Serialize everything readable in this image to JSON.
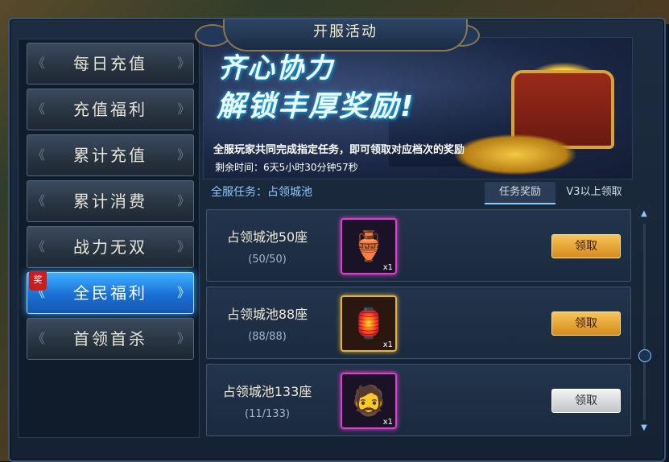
{
  "window": {
    "title": "开服活动"
  },
  "sidebar": {
    "items": [
      {
        "label": "每日充值"
      },
      {
        "label": "充值福利"
      },
      {
        "label": "累计充值"
      },
      {
        "label": "累计消费"
      },
      {
        "label": "战力无双"
      },
      {
        "label": "全民福利",
        "badge": "奖",
        "active": true
      },
      {
        "label": "首领首杀"
      }
    ]
  },
  "banner": {
    "title_line1": "齐心协力",
    "title_line2": "解锁丰厚奖励!",
    "description": "全服玩家共同完成指定任务，即可领取对应档次的奖励",
    "time_remaining": "剩余时间：6天5小时30分钟57秒"
  },
  "task_section": {
    "header": "全服任务：占领城池",
    "tabs": [
      {
        "label": "任务奖励",
        "active": true
      },
      {
        "label": "V3以上领取"
      }
    ]
  },
  "tasks": [
    {
      "name": "占领城池50座",
      "progress": "(50/50)",
      "item_icon": "porcelain-vase-icon",
      "item_count": "x1",
      "button": "领取",
      "button_style": "gold"
    },
    {
      "name": "占领城池88座",
      "progress": "(88/88)",
      "item_icon": "red-gourd-icon",
      "item_count": "x1",
      "button": "领取",
      "button_style": "gold"
    },
    {
      "name": "占领城池133座",
      "progress": "(11/133)",
      "item_icon": "warrior-portrait-icon",
      "item_count": "x1",
      "button": "领取",
      "button_style": "gray"
    }
  ]
}
